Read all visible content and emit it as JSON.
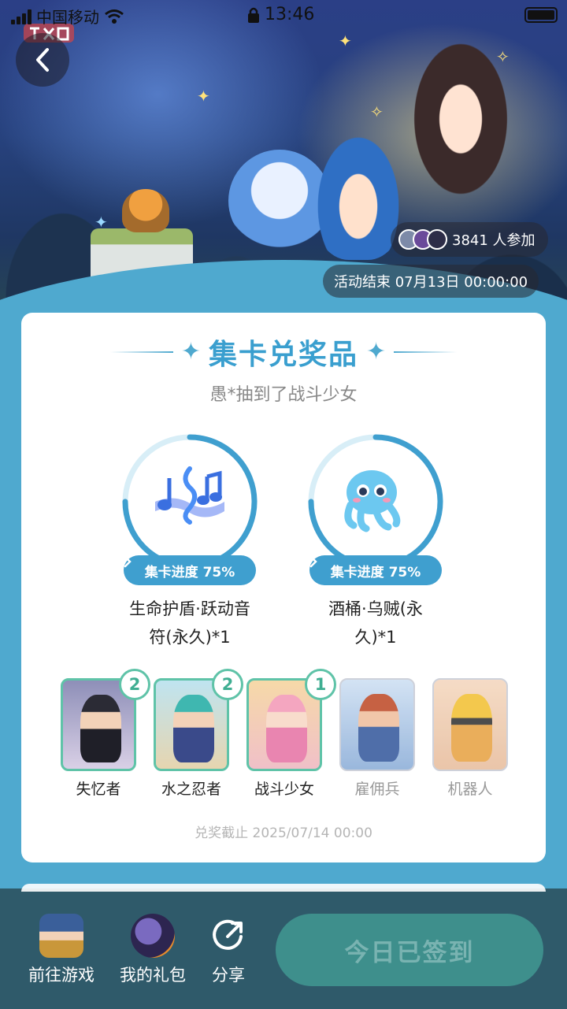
{
  "status_bar": {
    "carrier": "中国移动",
    "time": "13:46"
  },
  "hero": {
    "participants_text": "3841 人参加",
    "end_text": "活动结束 07月13日 00:00:00"
  },
  "card": {
    "title": "集卡兑奖品",
    "subtitle": "愚*抽到了战斗少女",
    "prizes": [
      {
        "progress_label": "集卡进度 75%",
        "progress": 0.75,
        "name_line1": "生命护盾·跃动音",
        "name_line2": "符(永久)*1",
        "icon": "music-notes-icon"
      },
      {
        "progress_label": "集卡进度 75%",
        "progress": 0.75,
        "name_line1": "酒桶·乌贼(永",
        "name_line2": "久)*1",
        "icon": "octopus-icon"
      }
    ],
    "characters": [
      {
        "name": "失忆者",
        "count": "2",
        "collected": true
      },
      {
        "name": "水之忍者",
        "count": "2",
        "collected": true
      },
      {
        "name": "战斗少女",
        "count": "1",
        "collected": true
      },
      {
        "name": "雇佣兵",
        "collected": false
      },
      {
        "name": "机器人",
        "collected": false
      }
    ],
    "deadline": "兑奖截止 2025/07/14 00:00"
  },
  "bottom_bar": {
    "go_game": "前往游戏",
    "my_gifts": "我的礼包",
    "share": "分享",
    "checkin": "今日已签到"
  },
  "colors": {
    "page_bg": "#4fa9cf",
    "accent": "#3a9fcf",
    "collected_border": "#5fc3a8",
    "bottom_bar": "#2f5a6a",
    "checkin_disabled": "#3e8f8c"
  }
}
